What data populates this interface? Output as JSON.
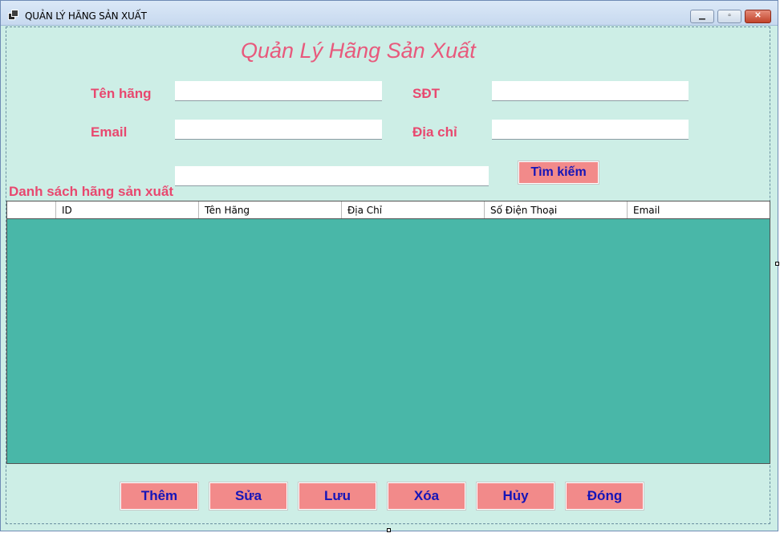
{
  "window": {
    "title": "QUẢN LÝ HÃNG SẢN XUẤT",
    "min_icon": "▁",
    "max_icon": "▫",
    "close_icon": "✕"
  },
  "form": {
    "heading": "Quản Lý Hãng Sản Xuất",
    "labels": {
      "ten_hang": "Tên hãng",
      "sdt": "SĐT",
      "email": "Email",
      "dia_chi": "Địa chỉ"
    },
    "fields": {
      "ten_hang": "",
      "sdt": "",
      "email": "",
      "dia_chi": "",
      "search": ""
    },
    "search_button": "Tìm kiếm",
    "list_label": "Danh sách hãng sản xuất"
  },
  "grid": {
    "columns": [
      "",
      "ID",
      "Tên Hãng",
      "Địa Chỉ",
      "Số Điện Thoại",
      "Email"
    ]
  },
  "actions": {
    "them": "Thêm",
    "sua": "Sửa",
    "luu": "Lưu",
    "xoa": "Xóa",
    "huy": "Hủy",
    "dong": "Đóng"
  },
  "colors": {
    "form_background": "#cdeee6",
    "label_color": "#e8486f",
    "heading_color": "#e8597c",
    "button_background": "#f28a8a",
    "button_text": "#1515b8",
    "grid_background": "#49b7a8"
  }
}
